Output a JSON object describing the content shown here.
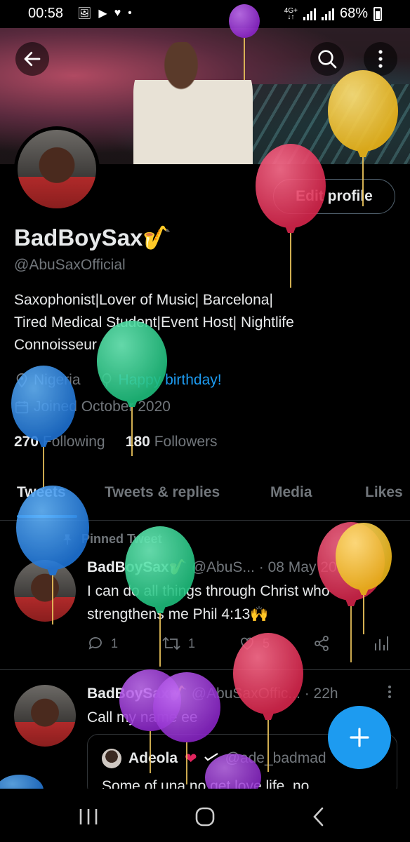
{
  "status_bar": {
    "time": "00:58",
    "network_top": "4G+",
    "network_bottom": "↓↑",
    "battery": "68%"
  },
  "profile": {
    "name": "BadBoySax🎷",
    "handle": "@AbuSaxOfficial",
    "edit_button": "Edit profile",
    "bio_line1": "Saxophonist|Lover of Music| Barcelona|",
    "bio_line2": "Tired Medical Student|Event Host| Nightlife",
    "bio_line3": "Connoisseur",
    "location": "Nigeria",
    "birthday": "Happy birthday!",
    "joined": "Joined October 2020",
    "following_count": "270",
    "following_label": "Following",
    "followers_count": "180",
    "followers_label": "Followers"
  },
  "tabs": [
    {
      "label": "Tweets",
      "active": true
    },
    {
      "label": "Tweets & replies",
      "active": false
    },
    {
      "label": "Media",
      "active": false
    },
    {
      "label": "Likes",
      "active": false
    }
  ],
  "tweets": [
    {
      "pinned_label": "Pinned Tweet",
      "name": "BadBoySax🎷",
      "handle": "@AbuS...",
      "time": "· 08 May 20",
      "body_line1": "I can do all things through Christ who",
      "body_line2": "strengthens me Phil 4:13🙌",
      "replies": "1",
      "retweets": "1",
      "likes": "5"
    },
    {
      "name": "BadBoySax🎷",
      "handle": "@AbuSaxOffic...",
      "time": "· 22h",
      "body": "Call my name ee",
      "quote": {
        "name": "Adeola",
        "handle": "@ade_badmad",
        "body": "Some of una no get love life, no"
      }
    }
  ],
  "colors": {
    "accent": "#1d9bf0",
    "background": "#000000",
    "text": "#e7e9ea",
    "secondary": "#71767b"
  }
}
